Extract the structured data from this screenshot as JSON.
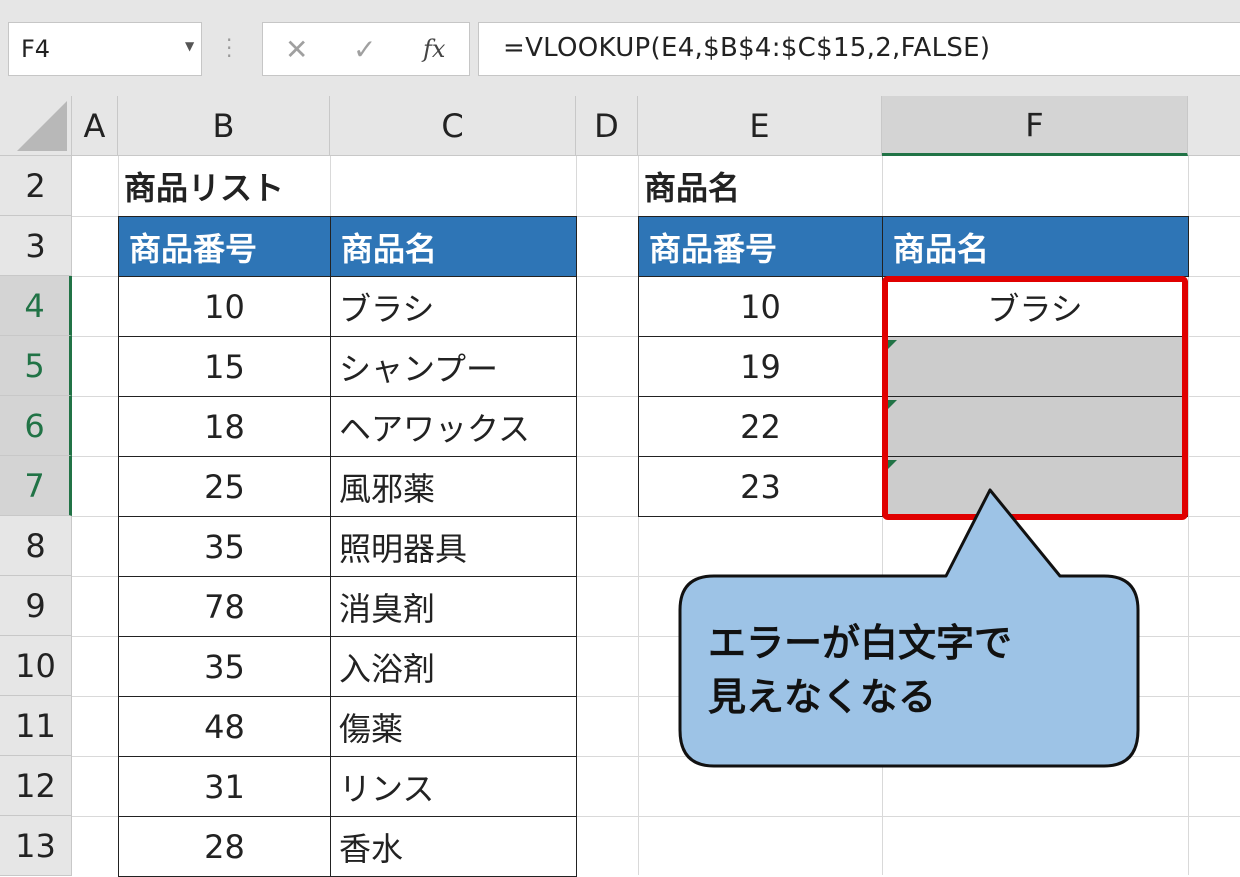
{
  "formula_bar": {
    "name_box": "F4",
    "cancel_icon": "✕",
    "enter_icon": "✓",
    "fx_label": "fx",
    "formula": "=VLOOKUP(E4,$B$4:$C$15,2,FALSE)"
  },
  "columns": [
    "A",
    "B",
    "C",
    "D",
    "E",
    "F"
  ],
  "rows": [
    "2",
    "3",
    "4",
    "5",
    "6",
    "7",
    "8",
    "9",
    "10",
    "11",
    "12",
    "13"
  ],
  "product_list": {
    "title": "商品リスト",
    "header_number": "商品番号",
    "header_name": "商品名",
    "items": [
      {
        "number": "10",
        "name": "ブラシ"
      },
      {
        "number": "15",
        "name": "シャンプー"
      },
      {
        "number": "18",
        "name": "ヘアワックス"
      },
      {
        "number": "25",
        "name": "風邪薬"
      },
      {
        "number": "35",
        "name": "照明器具"
      },
      {
        "number": "78",
        "name": "消臭剤"
      },
      {
        "number": "35",
        "name": "入浴剤"
      },
      {
        "number": "48",
        "name": "傷薬"
      },
      {
        "number": "31",
        "name": "リンス"
      },
      {
        "number": "28",
        "name": "香水"
      }
    ]
  },
  "lookup_table": {
    "title": "商品名",
    "header_number": "商品番号",
    "header_name": "商品名",
    "items": [
      {
        "number": "10",
        "name": "ブラシ"
      },
      {
        "number": "19",
        "name": ""
      },
      {
        "number": "22",
        "name": ""
      },
      {
        "number": "23",
        "name": ""
      }
    ]
  },
  "callout": {
    "line1": "エラーが白文字で",
    "line2": "見えなくなる",
    "fill_color": "#9dc3e6",
    "highlight_color": "#e00000"
  }
}
